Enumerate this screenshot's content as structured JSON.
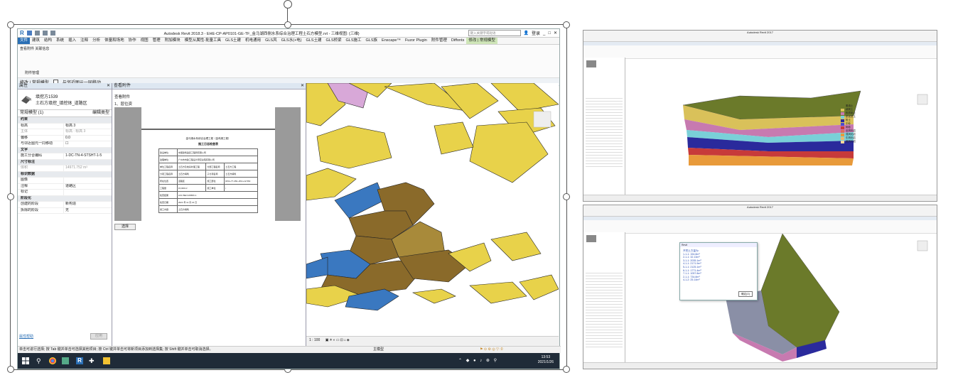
{
  "main_window": {
    "title": "Autodesk Revit 2018.3 -    EHE-CP-AP0101-GE-TF_金马湖西侧水系综合治理工程土石方模型.rvt - 三维视图: {三维}",
    "search_placeholder": "键入关键字或短语",
    "user": "登录",
    "menu_tabs": [
      "文件",
      "建筑",
      "结构",
      "系统",
      "插入",
      "注释",
      "分析",
      "体量和场地",
      "协作",
      "视图",
      "管理",
      "附加模块",
      "模型从属性-批量工具",
      "GLS土建",
      "机电通用",
      "GLS风",
      "GLS水(+电)",
      "GLS土建",
      "GLS桥梁",
      "GLS施工",
      "GLS族",
      "Enscape™",
      "Fuzor Plugin",
      "附件管理",
      "Diffonts",
      "修改 | 常规模型"
    ],
    "active_tab": "文件",
    "ribbon_label": "查看附件 关联信息",
    "ribbon_panel": "附件管理",
    "options_bar": {
      "context": "修改 | 常规模型",
      "checkbox_label": "与邻近图元一同移动"
    },
    "properties": {
      "header": "属性",
      "type_name": "填挖方1539",
      "type_sub": "土石方填挖_填挖体_道路区",
      "selector": "常规模型 (1)",
      "edit_type": "编辑类型",
      "rows": [
        {
          "k": "约束",
          "v": "",
          "group": true
        },
        {
          "k": "标高",
          "v": "标高 3"
        },
        {
          "k": "主体",
          "v": "标高 : 标高 3",
          "gray": true
        },
        {
          "k": "偏移",
          "v": "0.0"
        },
        {
          "k": "与邻近图元一同移动",
          "v": "☐"
        },
        {
          "k": "文字",
          "v": "",
          "group": true
        },
        {
          "k": "施工分合编码",
          "v": "1-DC-TN-4-STSHT-1-5"
        },
        {
          "k": "尺寸标注",
          "v": "",
          "group": true
        },
        {
          "k": "体积",
          "v": "14971.752 m³",
          "gray": true
        },
        {
          "k": "标识数据",
          "v": "",
          "group": true
        },
        {
          "k": "图像",
          "v": ""
        },
        {
          "k": "注释",
          "v": "道路区"
        },
        {
          "k": "标记",
          "v": ""
        },
        {
          "k": "阶段化",
          "v": "",
          "group": true
        },
        {
          "k": "创建的阶段",
          "v": "新构造"
        },
        {
          "k": "拆除的阶段",
          "v": "无"
        }
      ],
      "help_link": "属性帮助",
      "apply": "应用"
    },
    "attachments": {
      "header": "查看附件",
      "label1": "查看附件",
      "label2": "1、层位资料",
      "doc_title": "金马湖水系综合治理工程（金鸡湖工程）",
      "doc_heading": "施工日志检查表",
      "doc_rows": [
        [
          "建设单位",
          "中国建筑第四工程局有限公司",
          ""
        ],
        [
          "监理单位",
          "广州市市政工程设计研究总院有限公司",
          ""
        ],
        [
          "单位工程名称",
          "土石方及地基处理工程",
          "分部工程名称",
          "土石方工程"
        ],
        [
          "分项工程名称",
          "土石方填筑",
          "子分项名称",
          "土石方填筑"
        ],
        [
          "所在位置",
          "道路区",
          "施工部位",
          "RK0+77.260~ZK4+12.563"
        ],
        [
          "工程量",
          "15,000m³",
          "施工单位",
          "/"
        ],
        [
          "检查结果",
          "LDC BEnV20583-1",
          ""
        ],
        [
          "检查日期",
          "2021 年 11 月 21 日",
          ""
        ],
        [
          "施工内容",
          "土石方填筑",
          ""
        ]
      ],
      "select_btn": "选择"
    },
    "view_scale": "1 : 100",
    "status_text": "单击可进行选择; 按 Tab 键并单击可选择其他项目; 按 Ctrl 键并单击可将新项目添加到选择集; 按 Shift 键并单击可取消选择。",
    "status_model": "主模型",
    "clock_time": "13:53",
    "clock_date": "2021/1/26"
  },
  "right_top": {
    "title": "Autodesk Revit 2017",
    "legend": [
      "素填土",
      "填筑土",
      "粉质黏土",
      "淤泥质土",
      "粉土",
      "中砂",
      "砾砂",
      "全风化岩",
      "强风化岩",
      "中风化岩",
      "微风化岩"
    ],
    "colors": {
      "top": "#6b7a2a",
      "layer1": "#d9c15a",
      "layer2": "#c77ab0",
      "layer3": "#7ad0d8",
      "layer4": "#2a2a9c",
      "layer5": "#c73a3a",
      "layer6": "#e89a3a"
    }
  },
  "right_bottom": {
    "title": "Autodesk Revit 2017",
    "dialog_title": "Revit",
    "dialog_lines": [
      "开挖土方量为:",
      "1-1-1: 154.8m³",
      "2-1-1: 32.13m³",
      "3-1-1: 2035.1m³",
      "4-1-1: 2171.9m³",
      "5-1-1: 2125.1m³",
      "6-1-1: 1771.4m³",
      "7-1-1: 1057.8m³",
      "2-1-1: 734.8m³",
      "4-1-2: 25.14m³"
    ],
    "dialog_ok": "确定(O)"
  },
  "colors": {
    "accent": "#2a6fb5",
    "ribbon_green": "#cfe6b8",
    "taskbar": "#1f2b38",
    "fill_yellow": "#e8d24a",
    "fill_brown": "#8a6a2a",
    "fill_blue": "#3a78c0"
  }
}
